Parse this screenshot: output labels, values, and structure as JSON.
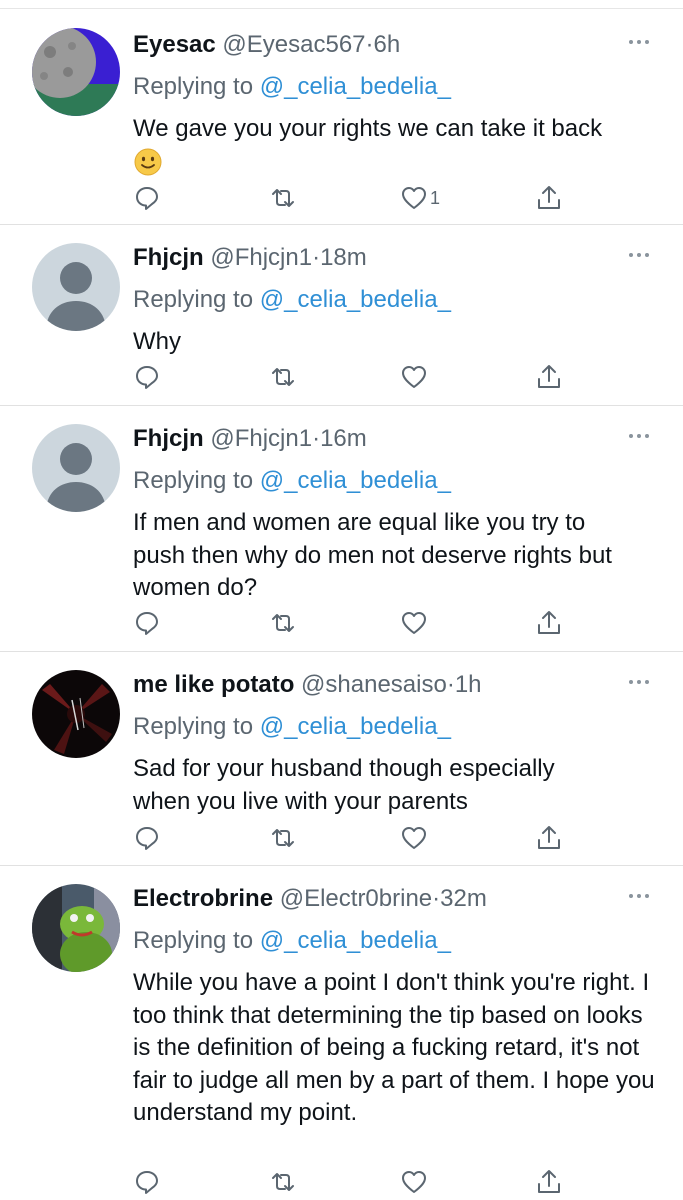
{
  "tweets": [
    {
      "name": "Eyesac",
      "handle": "@Eyesac567",
      "time": "6h",
      "replying_prefix": "Replying to",
      "replying_handle": "@_celia_bedelia_",
      "text": "We gave you your rights we can take it back",
      "emoji": "🙂",
      "like_count": "1",
      "avatar_icon": "moon-landscape-avatar"
    },
    {
      "name": "Fhjcjn",
      "handle": "@Fhjcjn1",
      "time": "18m",
      "replying_prefix": "Replying to",
      "replying_handle": "@_celia_bedelia_",
      "text": "Why",
      "avatar_icon": "default-avatar"
    },
    {
      "name": "Fhjcjn",
      "handle": "@Fhjcjn1",
      "time": "16m",
      "replying_prefix": "Replying to",
      "replying_handle": "@_celia_bedelia_",
      "text": "If men and women are equal like you try to push then why do men not deserve rights but women do?",
      "avatar_icon": "default-avatar"
    },
    {
      "name": "me like potato",
      "handle": "@shanesaiso",
      "time": "1h",
      "replying_prefix": "Replying to",
      "replying_handle": "@_celia_bedelia_",
      "text": "Sad for your husband though especially when you live with your parents",
      "avatar_icon": "dark-abstract-avatar"
    },
    {
      "name": "Electrobrine",
      "handle": "@Electr0brine",
      "time": "32m",
      "replying_prefix": "Replying to",
      "replying_handle": "@_celia_bedelia_",
      "text": "While you have a point I don't think you're right. I too think that determining the tip based on looks is the definition of being a fucking retard, it's not fair to judge all men by a part of them. I hope you understand my point.",
      "avatar_icon": "green-frog-avatar"
    }
  ],
  "colors": {
    "name": "#0f1419",
    "meta": "#5b6670",
    "link": "#2f8fd5",
    "separator": "#e1e1e1",
    "icon": "#5b6670"
  }
}
